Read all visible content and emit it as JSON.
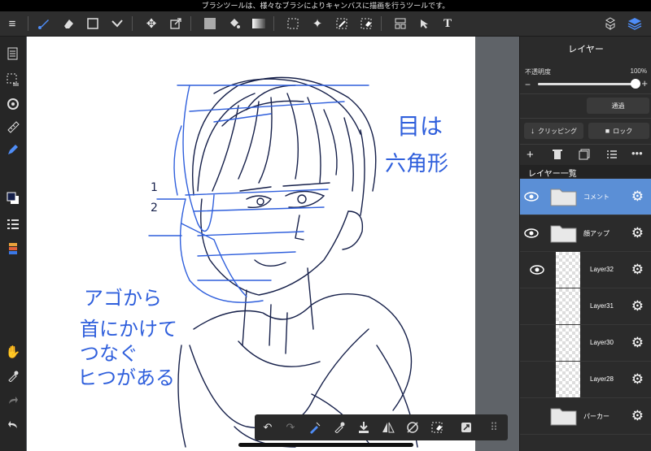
{
  "hint": "ブラシツールは、様々なブラシによりキャンバスに描画を行うツールです。",
  "toolbar": {
    "menu_icon": "≡",
    "tools": [
      "brush-icon",
      "eraser-icon",
      "rectangle-icon",
      "fill-dots-icon",
      "move-icon",
      "transform-icon",
      "color-square-icon",
      "bucket-icon",
      "gradient-icon",
      "select-rect-icon",
      "magic-wand-icon",
      "select-pen-icon",
      "select-eraser-icon",
      "layout-icon",
      "operation-icon",
      "text-icon"
    ],
    "text_tool": "T",
    "right_icons": [
      "materials-icon",
      "layers-icon"
    ]
  },
  "left_rail": [
    "pages-icon",
    "select-all-icon",
    "rotate-icon",
    "ruler-icon",
    "pen-icon",
    "color-icon",
    "layer-list-icon",
    "palette-icon",
    "hand-icon",
    "eyedropper-icon",
    "redo-icon",
    "undo-icon"
  ],
  "annotations": {
    "eyes": [
      "目は",
      "六角形"
    ],
    "chin": [
      "アゴから",
      "首にかけて",
      "つなぐ",
      "ヒつがある"
    ],
    "guide": [
      "1",
      "2"
    ]
  },
  "panel": {
    "title": "レイヤー",
    "opacity_label": "不透明度",
    "opacity_value": "100%",
    "opacity_fraction": 1.0,
    "blend_mode": "通過",
    "clipping_label": "クリッピング",
    "lock_label": "ロック",
    "list_title": "レイヤー一覧",
    "layers": [
      {
        "name": "コメント",
        "type": "folder",
        "selected": true
      },
      {
        "name": "顔アップ",
        "type": "folder",
        "selected": false
      },
      {
        "name": "Layer32",
        "type": "layer",
        "selected": false
      },
      {
        "name": "Layer31",
        "type": "layer",
        "selected": false
      },
      {
        "name": "Layer30",
        "type": "layer",
        "selected": false
      },
      {
        "name": "Layer28",
        "type": "layer",
        "selected": false
      },
      {
        "name": "パーカー",
        "type": "folder",
        "selected": false
      }
    ]
  },
  "colors": {
    "accent": "#4f8df7",
    "sketch": "#16204a",
    "annotation": "#2f5fdc",
    "selection": "#5b8fd6"
  }
}
